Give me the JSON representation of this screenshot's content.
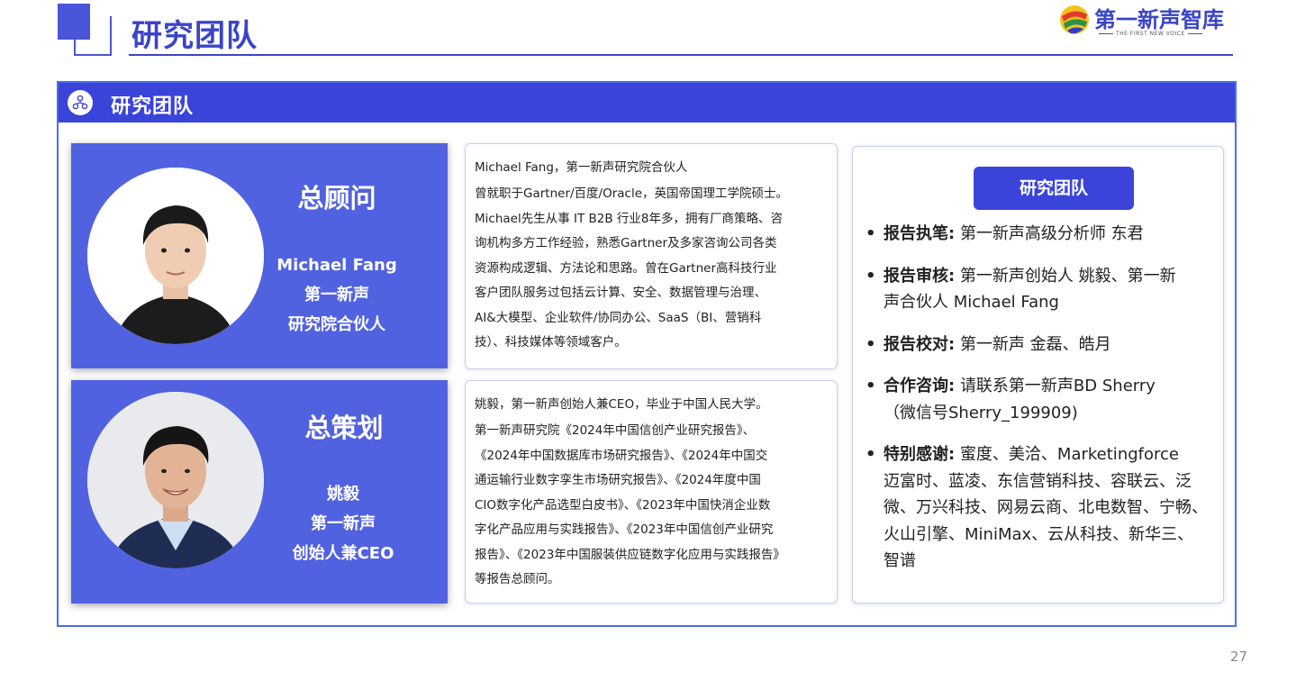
{
  "header": {
    "title": "研究团队",
    "logo_text": "第一新声智库",
    "logo_sub": "THE FIRST NEW VOICE"
  },
  "panel": {
    "title": "研究团队",
    "icon": "network-icon"
  },
  "advisor": {
    "role": "总顾问",
    "name": "Michael Fang",
    "org": "第一新声",
    "position": "研究院合伙人",
    "bio_lead": "Michael Fang，第一新声研究院合伙人",
    "bio_lines": [
      "曾就职于Gartner/百度/Oracle，英国帝国理工学院硕士。",
      "Michael先生从事 IT B2B 行业8年多，拥有厂商策略、咨",
      "询机构多方工作经验，熟悉Gartner及多家咨询公司各类",
      "资源构成逻辑、方法论和思路。曾在Gartner高科技行业",
      "客户团队服务过包括云计算、安全、数据管理与治理、",
      "AI&大模型、企业软件/协同办公、SaaS（BI、营销科",
      "技）、科技媒体等领域客户。"
    ]
  },
  "planner": {
    "role": "总策划",
    "name": "姚毅",
    "org": "第一新声",
    "position": "创始人兼CEO",
    "bio_lead": "姚毅，第一新声创始人兼CEO，毕业于中国人民大学。",
    "bio_lines": [
      "第一新声研究院《2024年中国信创产业研究报告》、",
      "《2024年中国数据库市场研究报告》、《2024年中国交",
      "通运输行业数字孪生市场研究报告》、《2024年度中国",
      "CIO数字化产品选型白皮书》、《2023年中国快消企业数",
      "字化产品应用与实践报告》、《2023年中国信创产业研究",
      "报告》、《2023年中国服装供应链数字化应用与实践报告》",
      "等报告总顾问。"
    ]
  },
  "team": {
    "button": "研究团队",
    "items": [
      {
        "key": "报告执笔:",
        "lines": [
          "第一新声高级分析师 东君"
        ]
      },
      {
        "key": "报告审核:",
        "lines": [
          "第一新声创始人 姚毅、第一新",
          "声合伙人 Michael Fang"
        ]
      },
      {
        "key": "报告校对:",
        "lines": [
          "第一新声 金磊、皓月"
        ]
      },
      {
        "key": "合作咨询:",
        "lines": [
          "请联系第一新声BD Sherry",
          "（微信号Sherry_199909)"
        ]
      },
      {
        "key": "特别感谢:",
        "lines": [
          "蜜度、美洽、Marketingforce",
          "迈富时、蓝凌、东信营销科技、容联云、泛",
          "微、万兴科技、网易云商、北电数智、宁畅、",
          "火山引擎、MiniMax、云从科技、新华三、",
          "智谱"
        ]
      }
    ]
  },
  "page_number": "27",
  "colors": {
    "primary": "#3a44d8",
    "card": "#5162e0",
    "border": "#4a6cf0"
  }
}
